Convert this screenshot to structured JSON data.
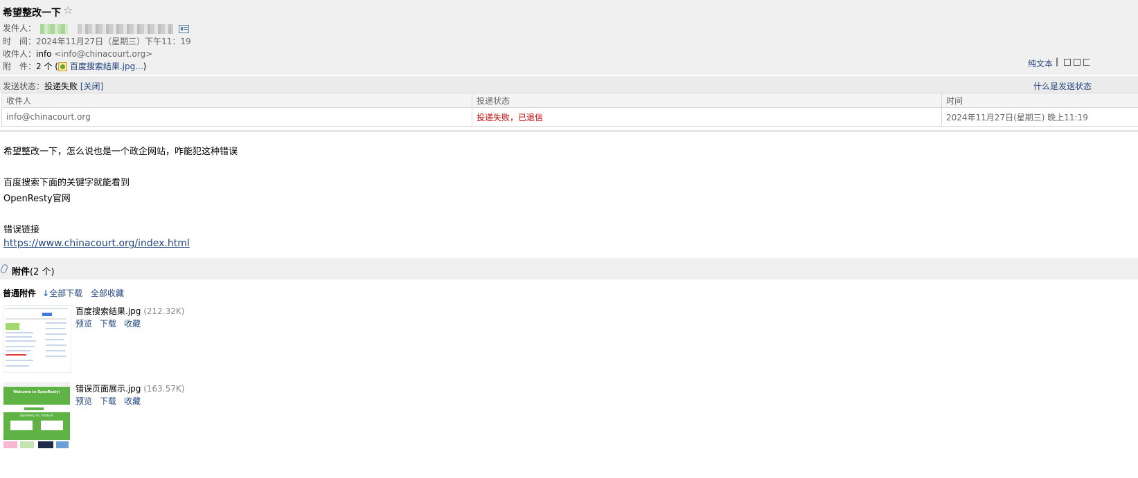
{
  "header": {
    "subject": "希望整改一下",
    "star": "☆",
    "from_label": "发件人：",
    "time_label": "时　间：",
    "time_value": "2024年11月27日（星期三）下午11：19",
    "to_label": "收件人：",
    "to_name": "info",
    "to_email": "<info@chinacourt.org>",
    "att_label": "附　件：",
    "att_count": "2 个",
    "att_open": "(",
    "att_first": "百度搜索结果.jpg...",
    "att_close": ")",
    "plaintext": "纯文本",
    "plaintext_sep": "|"
  },
  "status": {
    "label": "发送状态：",
    "value": "投递失败",
    "close": "[关闭]",
    "what_link": "什么是发送状态",
    "columns": [
      "收件人",
      "投递状态",
      "时间"
    ],
    "rows": [
      {
        "recipient": "info@chinacourt.org",
        "state": "投递失败，已退信",
        "time": "2024年11月27日(星期三) 晚上11:19"
      }
    ]
  },
  "body": {
    "line1": "希望整改一下，怎么说也是一个政企网站，咋能犯这种错误",
    "line2": "百度搜索下面的关键字就能看到",
    "line3": "OpenResty官网",
    "line4": "错误链接",
    "link": "https://www.chinacourt.org/index.html"
  },
  "attachments": {
    "title": "附件",
    "count": "(2 个)",
    "normal_label": "普通附件",
    "download_all": "全部下载",
    "collect_all": "全部收藏",
    "files": [
      {
        "name": "百度搜索结果.jpg",
        "size": "(212.32K)",
        "preview": "预览",
        "download": "下载",
        "collect": "收藏"
      },
      {
        "name": "错误页面展示.jpg",
        "size": "(163.57K)",
        "preview": "预览",
        "download": "下载",
        "collect": "收藏"
      }
    ],
    "thumb2_heading": "Welcome to OpenResty!",
    "thumb2_sub": "OpenResty Inc. Products"
  },
  "colors": {
    "link": "#24477e",
    "fail": "#cc0000",
    "header_bg": "#f0f0f0"
  }
}
